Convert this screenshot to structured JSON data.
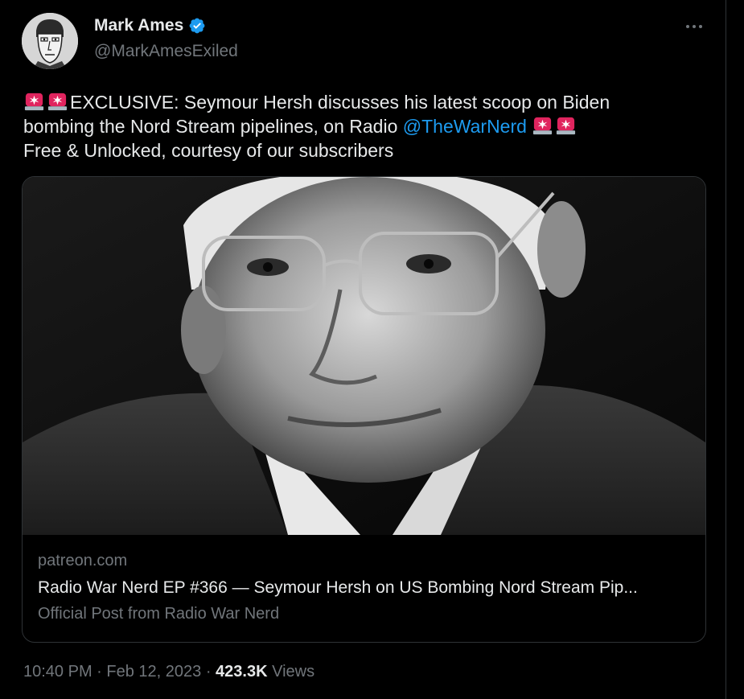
{
  "author": {
    "display_name": "Mark Ames",
    "handle": "@MarkAmesExiled",
    "verified_icon": "verified-badge-icon",
    "avatar_icon": "caricature-avatar"
  },
  "tweet": {
    "line1_text": "EXCLUSIVE: Seymour Hersh discusses his latest scoop on Biden",
    "line2_text": "bombing the Nord Stream pipelines, on Radio ",
    "mention": "@TheWarNerd",
    "line3_text": "Free & Unlocked, courtesy of our subscribers",
    "emoji_icon": "police-car-light-icon"
  },
  "card": {
    "image_alt": "Black and white portrait of an older man in glasses",
    "domain": "patreon.com",
    "title": "Radio War Nerd EP #366 — Seymour Hersh on US Bombing Nord Stream Pip...",
    "description": "Official Post from Radio War Nerd"
  },
  "meta": {
    "time": "10:40 PM",
    "date": "Feb 12, 2023",
    "separator": " · ",
    "views_count": "423.3K",
    "views_label": "Views"
  },
  "colors": {
    "background": "#000000",
    "text": "#e7e9ea",
    "muted": "#71767b",
    "link": "#1d9bf0",
    "border": "#2f3336",
    "verified": "#1d9bf0"
  }
}
